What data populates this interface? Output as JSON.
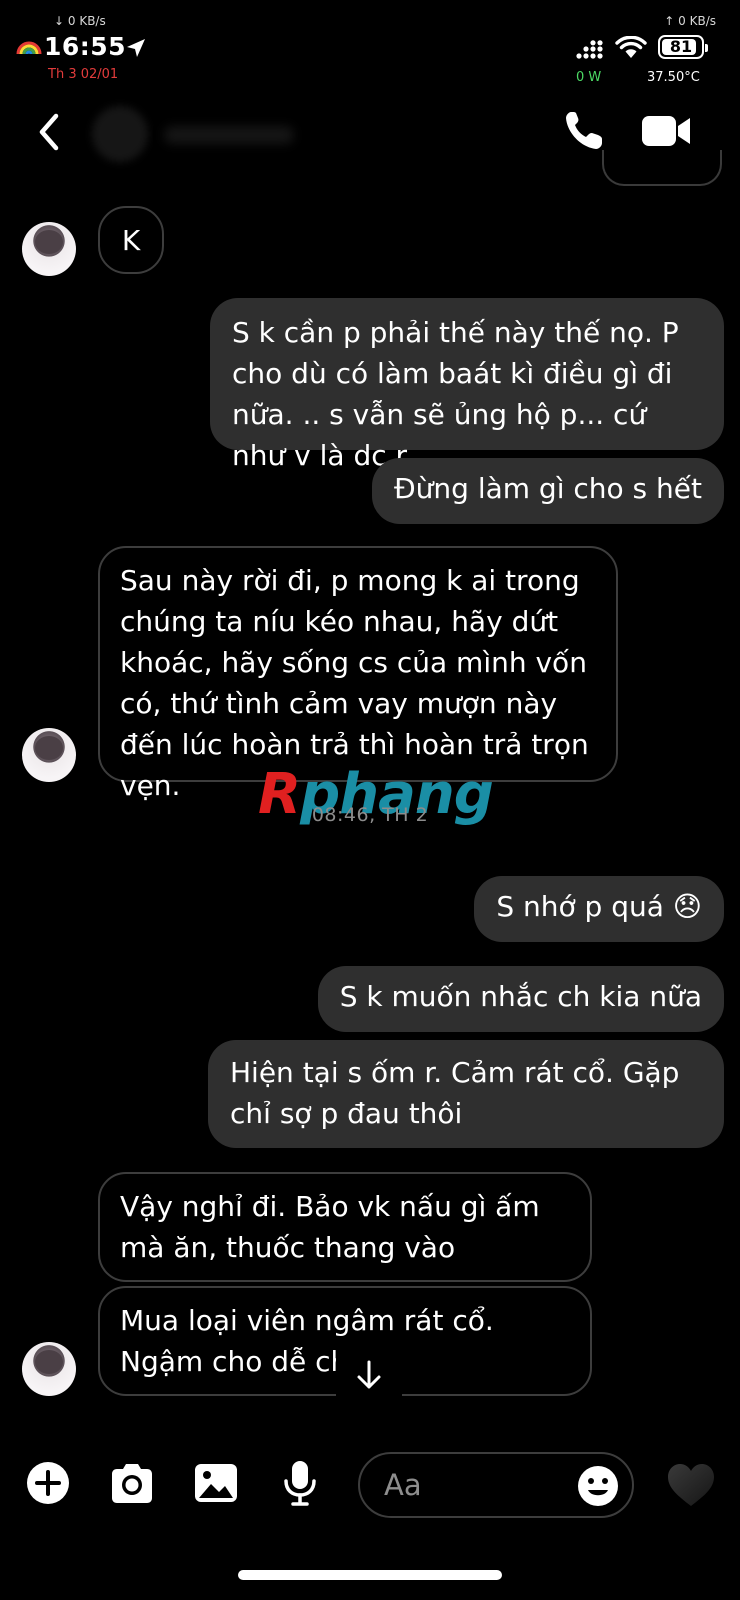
{
  "status_bar": {
    "net_down": "↓ 0 KB/s",
    "net_up": "↑ 0 KB/s",
    "time": "16:55",
    "date": "Th 3 02/01",
    "battery": "81",
    "power": "0 W",
    "temperature": "37.50°C",
    "icons": [
      "rainbow-icon",
      "location-arrow-icon",
      "signal-icon",
      "wifi-icon",
      "battery-icon"
    ]
  },
  "header": {
    "icons": [
      "back-arrow-icon",
      "phone-icon",
      "video-camera-icon"
    ]
  },
  "messages": [
    {
      "side": "in",
      "text": "K"
    },
    {
      "side": "out",
      "text": "S k cần p phải thế này thế nọ. P cho dù có làm baát kì điều gì đi nữa. .. s vẫn sẽ ủng hộ p... cứ như v là dc r"
    },
    {
      "side": "out",
      "text": "Đừng làm gì cho s hết"
    },
    {
      "side": "in",
      "text": "Sau này rời đi, p mong k ai trong chúng ta níu kéo nhau, hãy dứt khoác, hãy sống cs của mình vốn có, thứ tình cảm vay mượn này đến lúc hoàn trả thì hoàn trả trọn vẹn."
    },
    {
      "side": "out",
      "text": "S nhớ p quá 😞"
    },
    {
      "side": "out",
      "text": "S k muốn nhắc ch kia nữa"
    },
    {
      "side": "out",
      "text": "Hiện tại s ốm r. Cảm rát cổ. Gặp chỉ sợ p đau thôi"
    },
    {
      "side": "in",
      "text": "Vậy nghỉ đi. Bảo vk nấu gì ấm mà ăn, thuốc thang vào"
    },
    {
      "side": "in",
      "text": "Mua loại viên ngâm rát cổ. Ngậm cho dễ chịu"
    }
  ],
  "timestamp": "08:46, TH 2",
  "watermark": {
    "first": "R",
    "rest": "phang"
  },
  "composer": {
    "placeholder": "Aa",
    "icons": [
      "plus-icon",
      "camera-icon",
      "image-icon",
      "microphone-icon",
      "emoji-icon",
      "heart-icon"
    ]
  },
  "colors": {
    "background": "#000000",
    "outgoing_bubble": "#2f2f2f",
    "incoming_border": "#3d3d3d",
    "date_red": "#e23b3b",
    "power_green": "#4cd964",
    "watermark_red": "#e02020",
    "watermark_teal": "#1a8ea5"
  }
}
